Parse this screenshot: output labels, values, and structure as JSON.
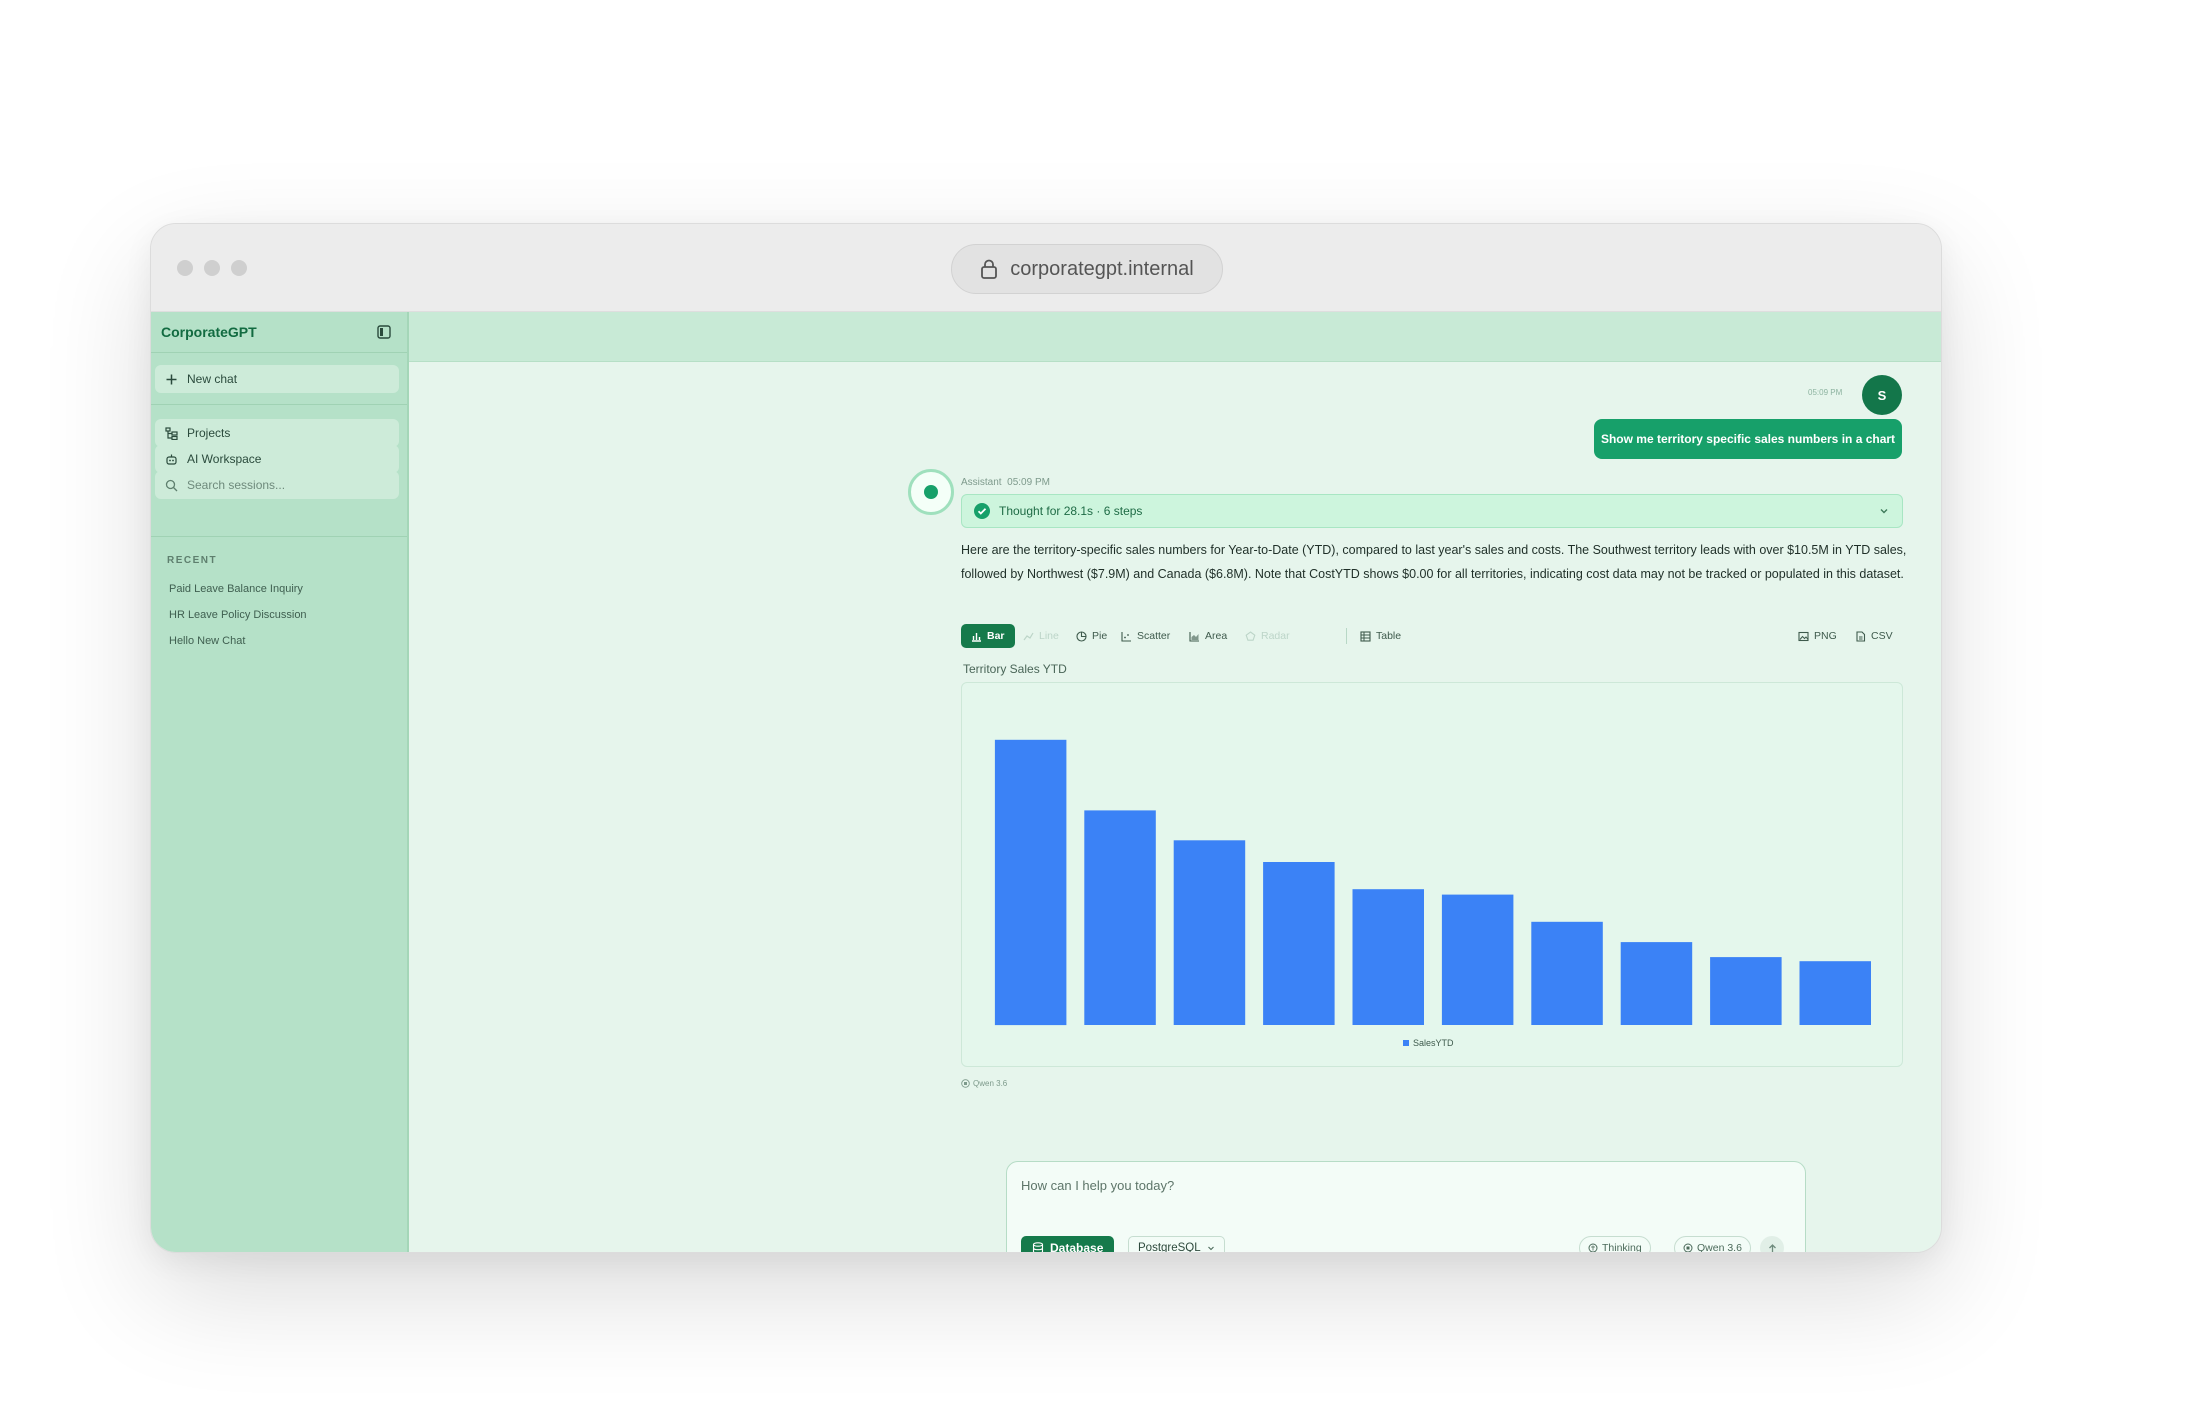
{
  "browser": {
    "url": "corporategpt.internal"
  },
  "sidebar": {
    "brand": "CorporateGPT",
    "new_chat": "New chat",
    "projects": "Projects",
    "ai_workspace": "AI Workspace",
    "search_placeholder": "Search sessions...",
    "recent_label": "RECENT",
    "recent_items": [
      "Paid Leave Balance Inquiry",
      "HR Leave Policy Discussion",
      "Hello New Chat"
    ]
  },
  "chat": {
    "user_time": "05:09 PM",
    "user_initial": "S",
    "user_message": "Show me territory specific sales numbers in a chart",
    "assistant_label": "Assistant",
    "assistant_time": "05:09 PM",
    "thought": "Thought for 28.1s · 6 steps",
    "answer": "Here are the territory-specific sales numbers for Year-to-Date (YTD), compared to last year's sales and costs. The Southwest territory leads with over $10.5M in YTD sales, followed by Northwest ($7.9M) and Canada ($6.8M). Note that CostYTD shows $0.00 for all territories, indicating cost data may not be tracked or populated in this dataset.",
    "model_tag": "Qwen 3.6"
  },
  "chart_toolbar": {
    "types": [
      "Bar",
      "Line",
      "Pie",
      "Scatter",
      "Area",
      "Radar"
    ],
    "active_type": "Bar",
    "table": "Table",
    "png": "PNG",
    "csv": "CSV"
  },
  "chart_data": {
    "type": "bar",
    "title": "Territory Sales YTD",
    "series": [
      {
        "name": "SalesYTD",
        "values": [
          10.5,
          7.9,
          6.8,
          6.0,
          5.0,
          4.8,
          3.8,
          3.05,
          2.5,
          2.35
        ]
      }
    ],
    "ylim": [
      0,
      12
    ],
    "legend": "bottom-center",
    "color": "#3b82f6"
  },
  "composer": {
    "placeholder": "How can I help you today?",
    "database": "Database",
    "db_engine": "PostgreSQL",
    "thinking": "Thinking",
    "model": "Qwen 3.6"
  }
}
